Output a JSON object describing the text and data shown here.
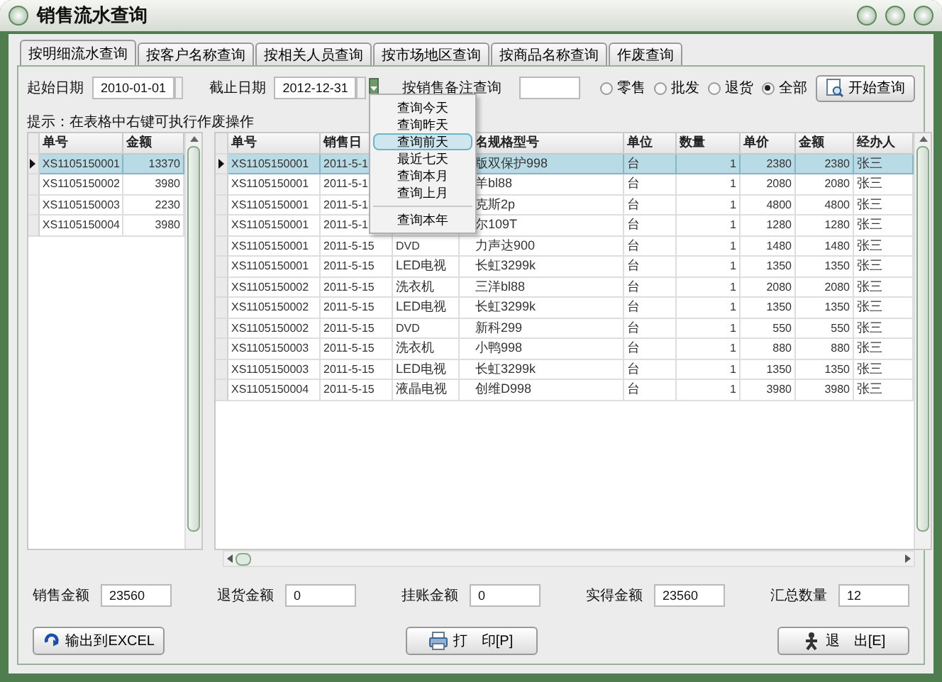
{
  "window": {
    "title": "销售流水查询"
  },
  "tabs": [
    {
      "label": "按明细流水查询",
      "selected": true
    },
    {
      "label": "按客户名称查询",
      "selected": false
    },
    {
      "label": "按相关人员查询",
      "selected": false
    },
    {
      "label": "按市场地区查询",
      "selected": false
    },
    {
      "label": "按商品名称查询",
      "selected": false
    },
    {
      "label": "作废查询",
      "selected": false
    }
  ],
  "filters": {
    "start_date": {
      "label": "起始日期",
      "value": "2010-01-01"
    },
    "end_date": {
      "label": "截止日期",
      "value": "2012-12-31"
    },
    "remark": {
      "label": "按销售备注查询"
    }
  },
  "sale_types": [
    {
      "label": "零售",
      "selected": false
    },
    {
      "label": "批发",
      "selected": false
    },
    {
      "label": "退货",
      "selected": false
    },
    {
      "label": "全部",
      "selected": true
    }
  ],
  "search_button": "开始查询",
  "hint": "提示：在表格中右键可执行作废操作",
  "date_menu": {
    "items": [
      {
        "kind": "item",
        "label": "查询今天",
        "selected": false
      },
      {
        "kind": "item",
        "label": "查询昨天",
        "selected": false
      },
      {
        "kind": "item",
        "label": "查询前天",
        "selected": true
      },
      {
        "kind": "item",
        "label": "最近七天",
        "selected": false
      },
      {
        "kind": "item",
        "label": "查询本月",
        "selected": false
      },
      {
        "kind": "item",
        "label": "查询上月",
        "selected": false
      },
      {
        "kind": "separator"
      },
      {
        "kind": "item",
        "label": "查询本年",
        "selected": false
      }
    ]
  },
  "orders_table": {
    "columns": [
      "单号",
      "金额"
    ],
    "rows": [
      {
        "cells": [
          "XS1105150001",
          "13370"
        ],
        "selected": true
      },
      {
        "cells": [
          "XS1105150002",
          "3980"
        ],
        "selected": false
      },
      {
        "cells": [
          "XS1105150003",
          "2230"
        ],
        "selected": false
      },
      {
        "cells": [
          "XS1105150004",
          "3980"
        ],
        "selected": false
      }
    ]
  },
  "details_table": {
    "columns": [
      "单号",
      "销售日",
      "",
      "名规格型号",
      "单位",
      "数量",
      "单价",
      "金额",
      "经办人"
    ],
    "rows": [
      {
        "cells": [
          "XS1105150001",
          "2011-5-1",
          null,
          "版双保护998",
          "台",
          "1",
          "2380",
          "2380",
          "张三"
        ],
        "selected": true
      },
      {
        "cells": [
          "XS1105150001",
          "2011-5-1",
          null,
          "羊bl88",
          "台",
          "1",
          "2080",
          "2080",
          "张三"
        ],
        "selected": false
      },
      {
        "cells": [
          "XS1105150001",
          "2011-5-1",
          null,
          "克斯2p",
          "台",
          "1",
          "4800",
          "4800",
          "张三"
        ],
        "selected": false
      },
      {
        "cells": [
          "XS1105150001",
          "2011-5-1",
          null,
          "尔109T",
          "台",
          "1",
          "1280",
          "1280",
          "张三"
        ],
        "selected": false
      },
      {
        "cells": [
          "XS1105150001",
          "2011-5-15",
          "DVD",
          "力声达900",
          "台",
          "1",
          "1480",
          "1480",
          "张三"
        ],
        "selected": false
      },
      {
        "cells": [
          "XS1105150001",
          "2011-5-15",
          "LED电视",
          "长虹3299k",
          "台",
          "1",
          "1350",
          "1350",
          "张三"
        ],
        "selected": false
      },
      {
        "cells": [
          "XS1105150002",
          "2011-5-15",
          "洗衣机",
          "三洋bl88",
          "台",
          "1",
          "2080",
          "2080",
          "张三"
        ],
        "selected": false
      },
      {
        "cells": [
          "XS1105150002",
          "2011-5-15",
          "LED电视",
          "长虹3299k",
          "台",
          "1",
          "1350",
          "1350",
          "张三"
        ],
        "selected": false
      },
      {
        "cells": [
          "XS1105150002",
          "2011-5-15",
          "DVD",
          "新科299",
          "台",
          "1",
          "550",
          "550",
          "张三"
        ],
        "selected": false
      },
      {
        "cells": [
          "XS1105150003",
          "2011-5-15",
          "洗衣机",
          "小鸭998",
          "台",
          "1",
          "880",
          "880",
          "张三"
        ],
        "selected": false
      },
      {
        "cells": [
          "XS1105150003",
          "2011-5-15",
          "LED电视",
          "长虹3299k",
          "台",
          "1",
          "1350",
          "1350",
          "张三"
        ],
        "selected": false
      },
      {
        "cells": [
          "XS1105150004",
          "2011-5-15",
          "液晶电视",
          "创维D998",
          "台",
          "1",
          "3980",
          "3980",
          "张三"
        ],
        "selected": false
      }
    ]
  },
  "totals": [
    {
      "label": "销售金额",
      "value": "23560"
    },
    {
      "label": "退货金额",
      "value": "0"
    },
    {
      "label": "挂账金额",
      "value": "0"
    },
    {
      "label": "实得金额",
      "value": "23560"
    },
    {
      "label": "汇总数量",
      "value": "12"
    }
  ],
  "buttons": [
    {
      "kind": "export",
      "label": "输出到EXCEL"
    },
    {
      "kind": "print",
      "label": "打　印[P]"
    },
    {
      "kind": "exit",
      "label": "退　出[E]"
    }
  ]
}
